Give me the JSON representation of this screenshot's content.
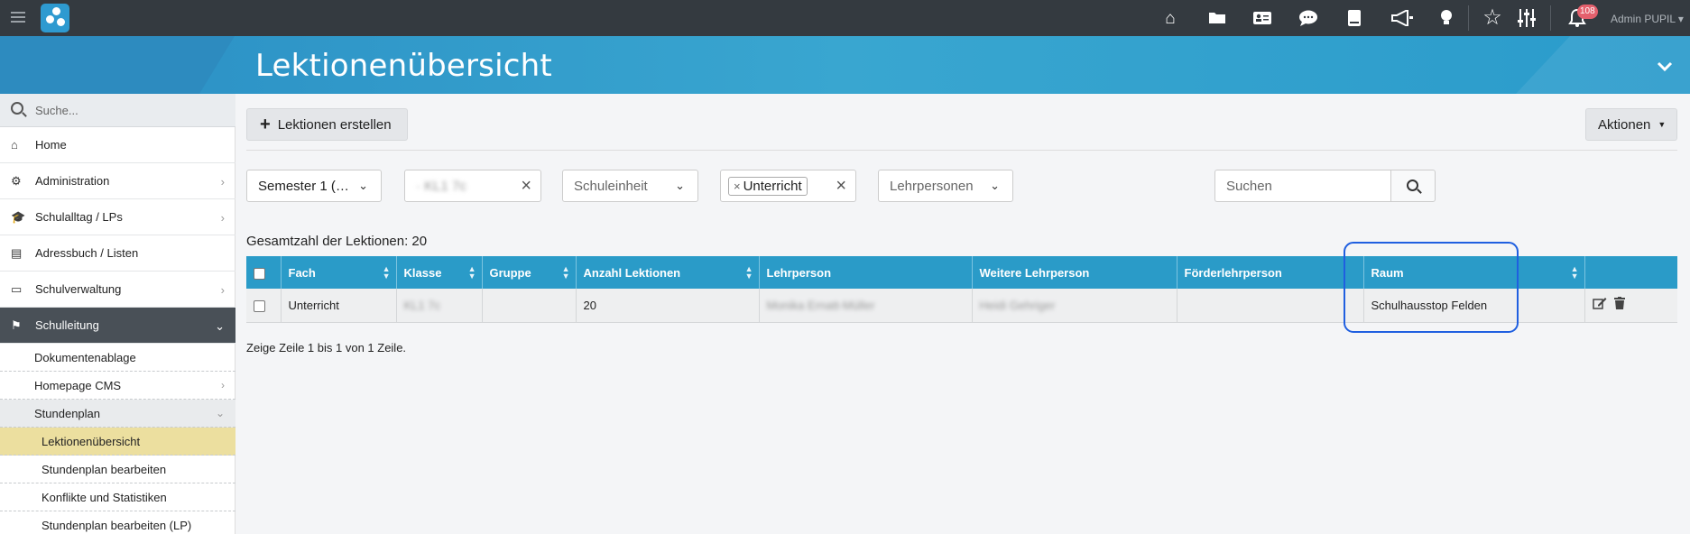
{
  "topbar": {
    "admin_label": "Admin PUPIL ▾",
    "notification_count": "108",
    "icons": [
      "home-icon",
      "folder-icon",
      "address-card-icon",
      "chat-icon",
      "book-icon",
      "megaphone-icon",
      "lightbulb-icon",
      "star-icon",
      "sliders-icon",
      "bell-icon"
    ]
  },
  "header": {
    "title": "Lektionenübersicht",
    "collapse_glyph": "⌄"
  },
  "sidebar": {
    "search_placeholder": "Suche...",
    "items": [
      {
        "label": "Home",
        "icon": "⌂"
      },
      {
        "label": "Administration",
        "icon": "⚙"
      },
      {
        "label": "Schulalltag / LPs",
        "icon": "🎓"
      },
      {
        "label": "Adressbuch / Listen",
        "icon": "▤"
      },
      {
        "label": "Schulverwaltung",
        "icon": "▭"
      },
      {
        "label": "Schulleitung",
        "icon": "⚑"
      }
    ],
    "sub_items": [
      {
        "label": "Dokumentenablage"
      },
      {
        "label": "Homepage CMS"
      },
      {
        "label": "Stundenplan"
      }
    ],
    "sub_sub_items": [
      {
        "label": "Lektionenübersicht"
      },
      {
        "label": "Stundenplan bearbeiten"
      },
      {
        "label": "Konflikte und Statistiken"
      },
      {
        "label": "Stundenplan bearbeiten (LP)"
      }
    ]
  },
  "toolbar": {
    "create_label": "Lektionen erstellen",
    "actions_label": "Aktionen"
  },
  "filters": {
    "semester": "Semester 1 (…",
    "klasse_blurred": "· KL1 7c",
    "schuleinheit_placeholder": "Schuleinheit",
    "tag_value": "Unterricht",
    "lehrpersonen_placeholder": "Lehrpersonen",
    "search_placeholder": "Suchen"
  },
  "summary": {
    "total_label": "Gesamtzahl der Lektionen: 20"
  },
  "table": {
    "columns": [
      "Fach",
      "Klasse",
      "Gruppe",
      "Anzahl Lektionen",
      "Lehrperson",
      "Weitere Lehrperson",
      "Förderlehrperson",
      "Raum"
    ],
    "rows": [
      {
        "fach": "Unterricht",
        "klasse": "KL1 7c",
        "gruppe": "",
        "anzahl": "20",
        "lehrperson": "Monika Ernatt-Müller",
        "weitere": "Heidi Gehriger",
        "foerder": "",
        "raum": "Schulhausstop Felden"
      }
    ]
  },
  "pagination": {
    "info": "Zeige Zeile 1 bis 1 von 1 Zeile."
  },
  "colors": {
    "accent": "#2a9bc8",
    "topbar": "#343a40",
    "highlight": "#1f5fe0",
    "selected_nav": "#ecdf9f"
  }
}
